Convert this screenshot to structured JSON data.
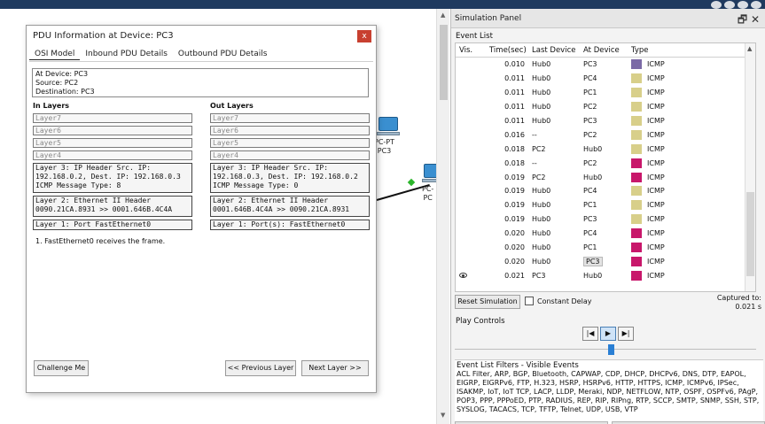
{
  "workspace": {
    "pc3_label": "PC-PT",
    "pc3_name": "PC3",
    "pc_right_label1": "PC-",
    "pc_right_label2": "PC"
  },
  "pdu_dialog": {
    "title": "PDU Information at Device: PC3",
    "tabs": [
      "OSI Model",
      "Inbound PDU Details",
      "Outbound PDU Details"
    ],
    "info": [
      "At Device: PC3",
      "Source: PC2",
      "Destination: PC3"
    ],
    "in_layers_title": "In Layers",
    "out_layers_title": "Out Layers",
    "in_layers": [
      "Layer7",
      "Layer6",
      "Layer5",
      "Layer4",
      "Layer 3: IP Header Src. IP: 192.168.0.2, Dest. IP: 192.168.0.3 ICMP Message Type: 8",
      "Layer 2: Ethernet II Header 0090.21CA.8931 >> 0001.646B.4C4A",
      "Layer 1: Port FastEthernet0"
    ],
    "out_layers": [
      "Layer7",
      "Layer6",
      "Layer5",
      "Layer4",
      "Layer 3: IP Header Src. IP: 192.168.0.3, Dest. IP: 192.168.0.2 ICMP Message Type: 0",
      "Layer 2: Ethernet II Header 0001.646B.4C4A >> 0090.21CA.8931",
      "Layer 1: Port(s): FastEthernet0"
    ],
    "description": "1. FastEthernet0 receives the frame.",
    "challenge_button": "Challenge Me",
    "prev_button": "<< Previous Layer",
    "next_button": "Next Layer >>",
    "close_label": "x"
  },
  "sim_panel": {
    "title": "Simulation Panel",
    "event_list_label": "Event List",
    "columns": [
      "Vis.",
      "Time(sec)",
      "Last Device",
      "At Device",
      "Type"
    ],
    "events": [
      {
        "vis": "",
        "time": "0.010",
        "last": "Hub0",
        "at": "PC3",
        "type": "ICMP",
        "color": "#7b6aa6"
      },
      {
        "vis": "",
        "time": "0.011",
        "last": "Hub0",
        "at": "PC4",
        "type": "ICMP",
        "color": "#d8cf8a"
      },
      {
        "vis": "",
        "time": "0.011",
        "last": "Hub0",
        "at": "PC1",
        "type": "ICMP",
        "color": "#d8cf8a"
      },
      {
        "vis": "",
        "time": "0.011",
        "last": "Hub0",
        "at": "PC2",
        "type": "ICMP",
        "color": "#d8cf8a"
      },
      {
        "vis": "",
        "time": "0.011",
        "last": "Hub0",
        "at": "PC3",
        "type": "ICMP",
        "color": "#d8cf8a"
      },
      {
        "vis": "",
        "time": "0.016",
        "last": "--",
        "at": "PC2",
        "type": "ICMP",
        "color": "#d8cf8a"
      },
      {
        "vis": "",
        "time": "0.018",
        "last": "PC2",
        "at": "Hub0",
        "type": "ICMP",
        "color": "#d8cf8a"
      },
      {
        "vis": "",
        "time": "0.018",
        "last": "--",
        "at": "PC2",
        "type": "ICMP",
        "color": "#c8176b"
      },
      {
        "vis": "",
        "time": "0.019",
        "last": "PC2",
        "at": "Hub0",
        "type": "ICMP",
        "color": "#c8176b"
      },
      {
        "vis": "",
        "time": "0.019",
        "last": "Hub0",
        "at": "PC4",
        "type": "ICMP",
        "color": "#d8cf8a"
      },
      {
        "vis": "",
        "time": "0.019",
        "last": "Hub0",
        "at": "PC1",
        "type": "ICMP",
        "color": "#d8cf8a"
      },
      {
        "vis": "",
        "time": "0.019",
        "last": "Hub0",
        "at": "PC3",
        "type": "ICMP",
        "color": "#d8cf8a"
      },
      {
        "vis": "",
        "time": "0.020",
        "last": "Hub0",
        "at": "PC4",
        "type": "ICMP",
        "color": "#c8176b"
      },
      {
        "vis": "",
        "time": "0.020",
        "last": "Hub0",
        "at": "PC1",
        "type": "ICMP",
        "color": "#c8176b"
      },
      {
        "vis": "",
        "time": "0.020",
        "last": "Hub0",
        "at": "PC3",
        "type": "ICMP",
        "color": "#c8176b"
      },
      {
        "vis": "eye",
        "time": "0.021",
        "last": "PC3",
        "at": "Hub0",
        "type": "ICMP",
        "color": "#c8176b"
      }
    ],
    "reset_button": "Reset Simulation",
    "constant_delay_label": "Constant Delay",
    "captured_label": "Captured to:",
    "captured_value": "0.021 s",
    "play_controls_label": "Play Controls",
    "filters_title": "Event List Filters - Visible Events",
    "filters_text": "ACL Filter, ARP, BGP, Bluetooth, CAPWAP, CDP, DHCP, DHCPv6, DNS, DTP, EAPOL, EIGRP, EIGRPv6, FTP, H.323, HSRP, HSRPv6, HTTP, HTTPS, ICMP, ICMPv6, IPSec, ISAKMP, IoT, IoT TCP, LACP, LLDP, Meraki, NDP, NETFLOW, NTP, OSPF, OSPFv6, PAgP, POP3, PPP, PPPoED, PTP, RADIUS, REP, RIP, RIPng, RTP, SCCP, SMTP, SNMP, SSH, STP, SYSLOG, TACACS, TCP, TFTP, Telnet, UDP, USB, VTP"
  }
}
